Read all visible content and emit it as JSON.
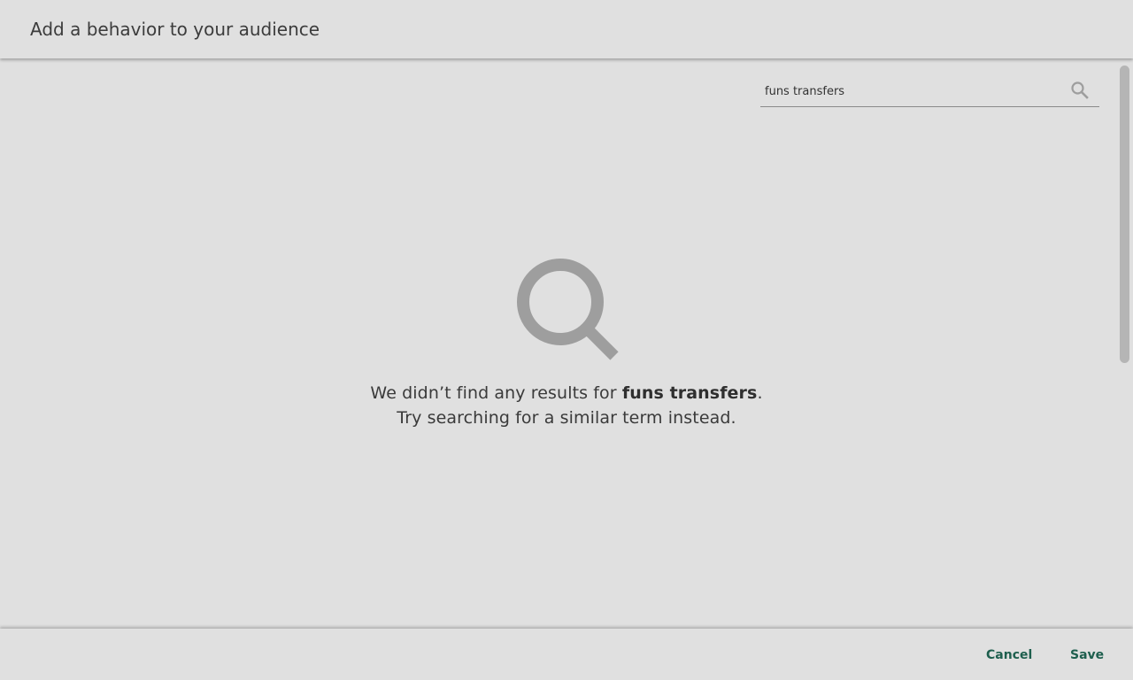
{
  "header": {
    "title": "Add a behavior to your audience"
  },
  "search": {
    "value": "funs transfers",
    "icon": "search-icon"
  },
  "empty_state": {
    "icon": "magnifier-icon",
    "message_prefix": "We didn’t find any results for ",
    "query": "funs transfers",
    "message_suffix": ".",
    "hint": "Try searching for a similar term instead."
  },
  "footer": {
    "cancel_label": "Cancel",
    "save_label": "Save"
  },
  "colors": {
    "background": "#e0e0e0",
    "accent": "#1e5f4e",
    "icon_gray": "#9e9e9e"
  }
}
